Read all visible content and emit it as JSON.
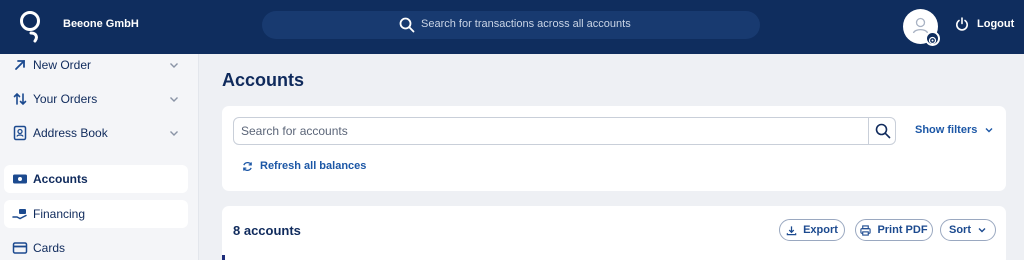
{
  "header": {
    "company": "Beeone GmbH",
    "search_placeholder": "Search for transactions across all accounts",
    "logout_label": "Logout"
  },
  "sidebar": {
    "items": [
      {
        "label": "New Order",
        "icon": "arrow-up-right-icon",
        "expandable": true
      },
      {
        "label": "Your Orders",
        "icon": "swap-vertical-icon",
        "expandable": true
      },
      {
        "label": "Address Book",
        "icon": "address-book-icon",
        "expandable": true
      },
      {
        "label": "Accounts",
        "icon": "accounts-icon",
        "active": true
      },
      {
        "label": "Financing",
        "icon": "financing-icon"
      },
      {
        "label": "Cards",
        "icon": "cards-icon"
      }
    ]
  },
  "main": {
    "title": "Accounts",
    "search_placeholder": "Search for accounts",
    "show_filters_label": "Show filters",
    "refresh_label": "Refresh all balances",
    "count_label": "8 accounts",
    "export_label": "Export",
    "print_label": "Print PDF",
    "sort_label": "Sort"
  },
  "colors": {
    "header_bg": "#0f2d5e",
    "accent": "#1c57a6",
    "text": "#0f2a5c",
    "page_bg": "#eef0f4"
  }
}
